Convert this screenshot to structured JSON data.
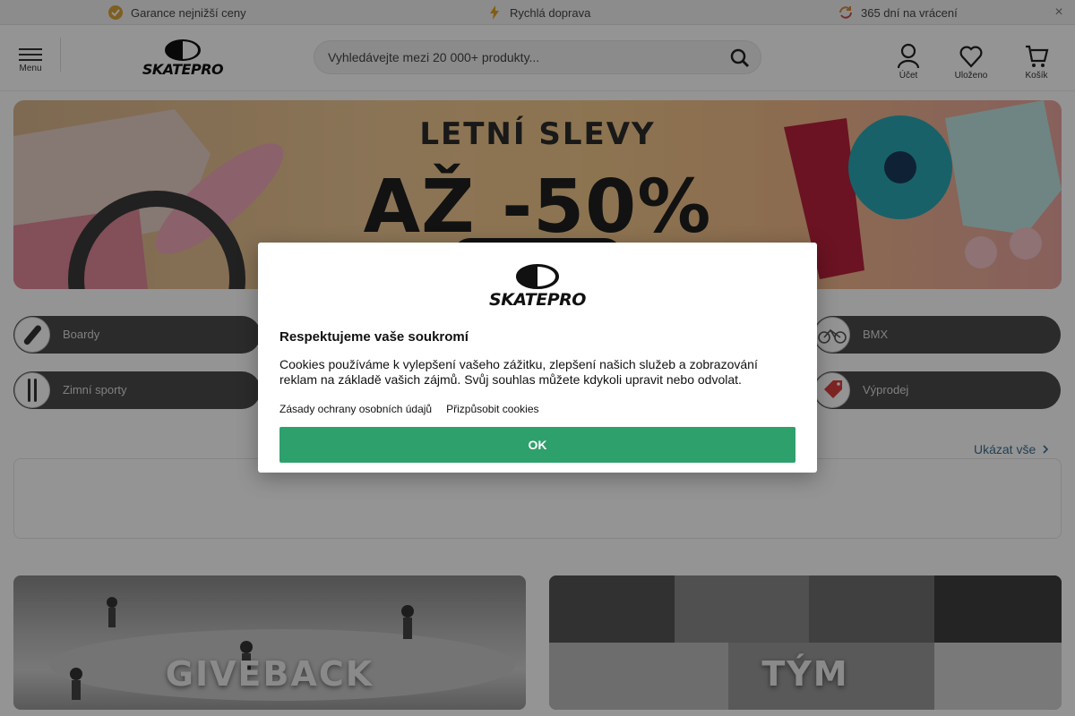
{
  "topbar": {
    "usps": [
      {
        "icon": "badge-check-icon",
        "text": "Garance nejnižší ceny"
      },
      {
        "icon": "lightning-icon",
        "text": "Rychlá doprava"
      },
      {
        "icon": "return-arrows-icon",
        "text": "365 dní na vrácení"
      }
    ],
    "close_label": "×"
  },
  "header": {
    "menu_label": "Menu",
    "logo_text": "SKATEPRO",
    "search_placeholder": "Vyhledávejte mezi 20 000+ produkty...",
    "actions": [
      {
        "icon": "user-icon",
        "label": "Účet"
      },
      {
        "icon": "heart-icon",
        "label": "Uloženo"
      },
      {
        "icon": "cart-icon",
        "label": "Košík"
      }
    ]
  },
  "banner": {
    "line1": "LETNÍ SLEVY",
    "line2": "AŽ -50%"
  },
  "categories": [
    {
      "name": "Boardy",
      "icon": "skateboard-icon"
    },
    {
      "name": "BMX",
      "icon": "bicycle-icon"
    },
    {
      "name": "Zimní sporty",
      "icon": "skis-icon"
    },
    {
      "name": "Výprodej",
      "icon": "sale-tag-icon"
    }
  ],
  "show_all": "Ukázat vše",
  "tiles": [
    {
      "label": "GIVEBACK"
    },
    {
      "label": "TÝM"
    }
  ],
  "cookie_modal": {
    "logo_text": "SKATEPRO",
    "title": "Respektujeme vaše soukromí",
    "body": "Cookies používáme k vylepšení vašeho zážitku, zlepšení našich služeb a zobrazování reklam na základě vašich zájmů. Svůj souhlas můžete kdykoli upravit nebo odvolat.",
    "link_privacy": "Zásady ochrany osobních údajů",
    "link_customize": "Přizpůsobit cookies",
    "ok_label": "OK"
  },
  "colors": {
    "accent_green": "#2ea06c",
    "link_blue": "#3d6e8f",
    "pill_bg": "#4a4a4a"
  }
}
